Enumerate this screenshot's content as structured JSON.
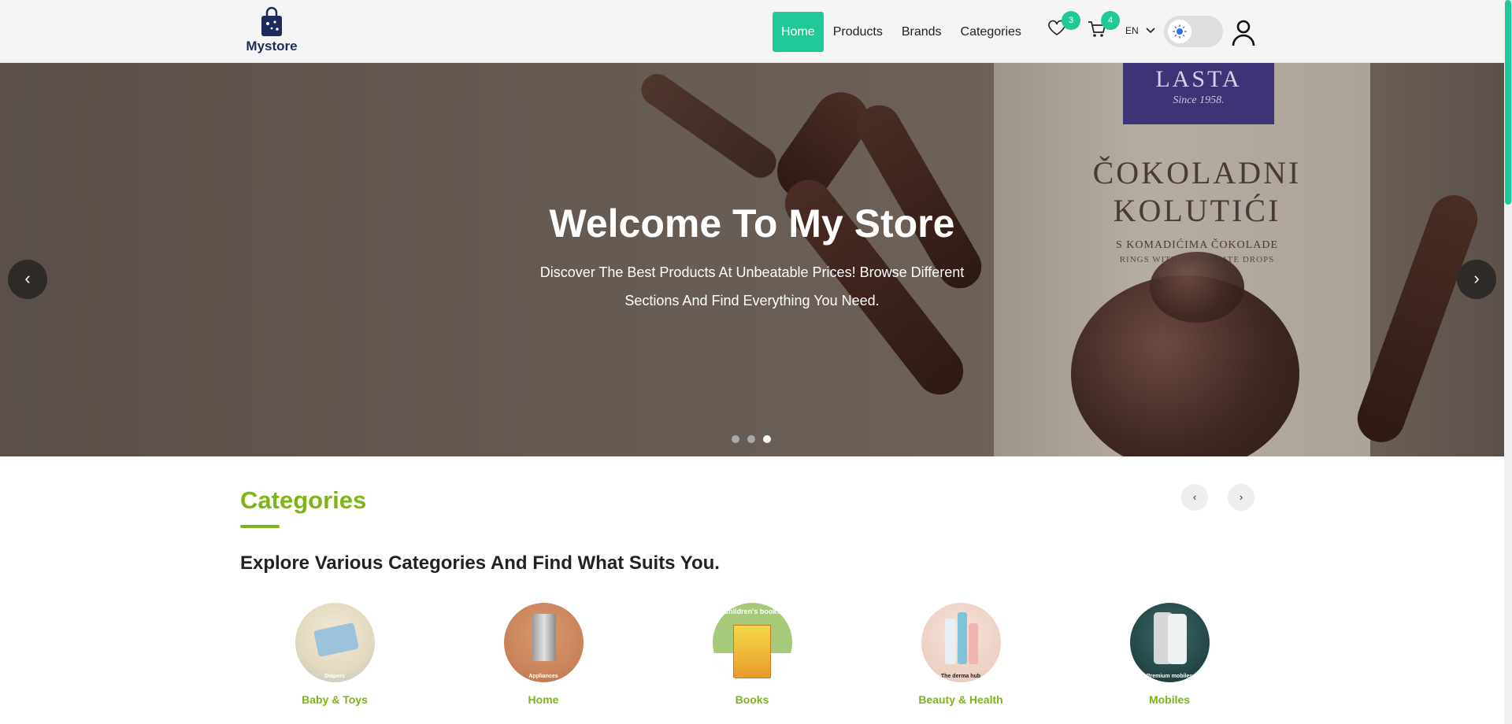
{
  "brand": {
    "name": "Mystore"
  },
  "nav": {
    "links": [
      {
        "label": "Home",
        "active": true
      },
      {
        "label": "Products",
        "active": false
      },
      {
        "label": "Brands",
        "active": false
      },
      {
        "label": "Categories",
        "active": false
      }
    ],
    "wishlist_count": "3",
    "cart_count": "4",
    "language": "EN",
    "theme_mode": "light"
  },
  "hero": {
    "title": "Welcome To My Store",
    "subtitle": "Discover The Best Products At Unbeatable Prices! Browse Different Sections And Find Everything You Need.",
    "prev_label": "‹",
    "next_label": "›",
    "slide_count": 3,
    "active_slide": 3,
    "packaging": {
      "brand": "LASTA",
      "since": "Since 1958.",
      "product_line1": "ČOKOLADNI",
      "product_line2": "KOLUTIĆI",
      "desc1": "S KOMADIĆIMA ČOKOLADE",
      "desc2": "RINGS WITH CHOCOLATE DROPS"
    }
  },
  "categories": {
    "heading": "Categories",
    "subheading": "Explore Various Categories And Find What Suits You.",
    "prev_label": "‹",
    "next_label": "›",
    "items": [
      {
        "label": "Baby & Toys",
        "caption": "Diapers"
      },
      {
        "label": "Home",
        "caption": "Appliances"
      },
      {
        "label": "Books",
        "caption": "Children's books"
      },
      {
        "label": "Beauty & Health",
        "caption": "The derma hub"
      },
      {
        "label": "Mobiles",
        "caption": "Premium mobiles"
      }
    ]
  },
  "colors": {
    "accent": "#20c997",
    "category_green": "#7cb518",
    "brand_navy": "#1f2a5c"
  }
}
